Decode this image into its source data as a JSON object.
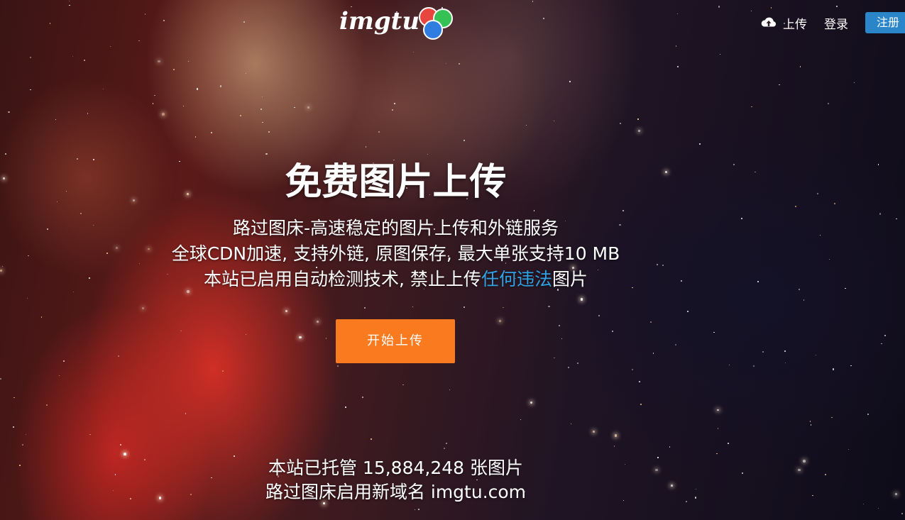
{
  "header": {
    "logo_text": "imgtu",
    "logo_colors": [
      "#e6463e",
      "#35c153",
      "#2f7de1"
    ],
    "nav": {
      "upload_label": "上传",
      "upload_icon": "cloud-upload-icon",
      "login_label": "登录",
      "register_label": "注册"
    }
  },
  "hero": {
    "title": "免费图片上传",
    "line1": "路过图床-高速稳定的图片上传和外链服务",
    "line2": "全球CDN加速, 支持外链, 原图保存, 最大单张支持10 MB",
    "line3_prefix": "本站已启用自动检测技术, 禁止上传",
    "line3_highlight": "任何违法",
    "line3_suffix": "图片",
    "start_button": "开始上传"
  },
  "stats": {
    "hosted_prefix": "本站已托管 ",
    "hosted_count": "15,884,248",
    "hosted_suffix": " 张图片",
    "domain_notice": "路过图床启用新域名 imgtu.com"
  },
  "colors": {
    "accent_orange": "#f97a1f",
    "register_blue": "#2a86c8",
    "highlight_blue": "#2fa3e6"
  }
}
